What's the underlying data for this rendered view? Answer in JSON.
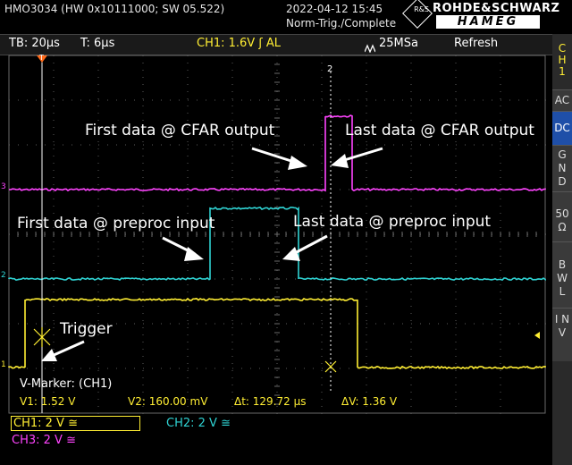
{
  "header": {
    "model": "HMO3034 (HW 0x10111000; SW 05.522)",
    "datetime": "2022-04-12 15:45",
    "trigger_state": "Norm-Trig./Complete",
    "brand_top": "ROHDE&SCHWARZ",
    "brand_bottom": "HAMEG",
    "brand_logo": "R&S"
  },
  "statusbar": {
    "timebase": "TB: 20µs",
    "trigger_time": "T: 6µs",
    "ch1_trigger": "CH1: 1.6V ʃ AL",
    "sample_rate": "25MSa",
    "refresh": "Refresh"
  },
  "sidebar": {
    "channel": [
      "C",
      "H",
      "1"
    ],
    "buttons": [
      {
        "label": "AC",
        "active": false
      },
      {
        "label": "DC",
        "active": true
      },
      {
        "label": "G N D",
        "active": false
      },
      {
        "label": "50 Ω",
        "active": false
      },
      {
        "label": "B W L",
        "active": false
      },
      {
        "label": "I N V",
        "active": false
      }
    ]
  },
  "annotations": {
    "first_cfar": "First data @ CFAR output",
    "last_cfar": "Last data @ CFAR output",
    "first_preproc": "First data @ preproc input",
    "last_preproc": "Last data @ preproc input",
    "trigger": "Trigger"
  },
  "markers": {
    "ch3_level": "3",
    "ch2_level": "2",
    "ch1_level": "1",
    "trigger_pos": "T",
    "cursor_2": "2"
  },
  "cursors": {
    "title": "V-Marker: (CH1)",
    "v1": "V1: 1.52 V",
    "v2": "V2: 160.00 mV",
    "dt": "Δt: 129.72 µs",
    "dv": "ΔV: 1.36 V"
  },
  "channels": {
    "ch1": "CH1: 2 V ≅",
    "ch2": "CH2: 2 V ≅",
    "ch3": "CH3: 2 V ≅"
  },
  "colors": {
    "ch1": "#ffee33",
    "ch2": "#2fd3d3",
    "ch3": "#ff44ff",
    "marker_orange": "#ff6a1a"
  },
  "chart_data": {
    "type": "line",
    "xlim": [
      0,
      200
    ],
    "x_unit": "µs",
    "grid": true,
    "series": [
      {
        "channel": "CH3",
        "x": [
          0,
          118,
          118,
          128,
          128,
          200
        ],
        "y": [
          0,
          0,
          1,
          1,
          0,
          0
        ]
      },
      {
        "channel": "CH2",
        "x": [
          0,
          75,
          75,
          108,
          108,
          200
        ],
        "y": [
          0,
          0,
          1,
          1,
          0,
          0
        ]
      },
      {
        "channel": "CH1",
        "x": [
          0,
          6,
          6,
          130,
          130,
          200
        ],
        "y": [
          0,
          0,
          1,
          1,
          0,
          0
        ]
      }
    ]
  }
}
